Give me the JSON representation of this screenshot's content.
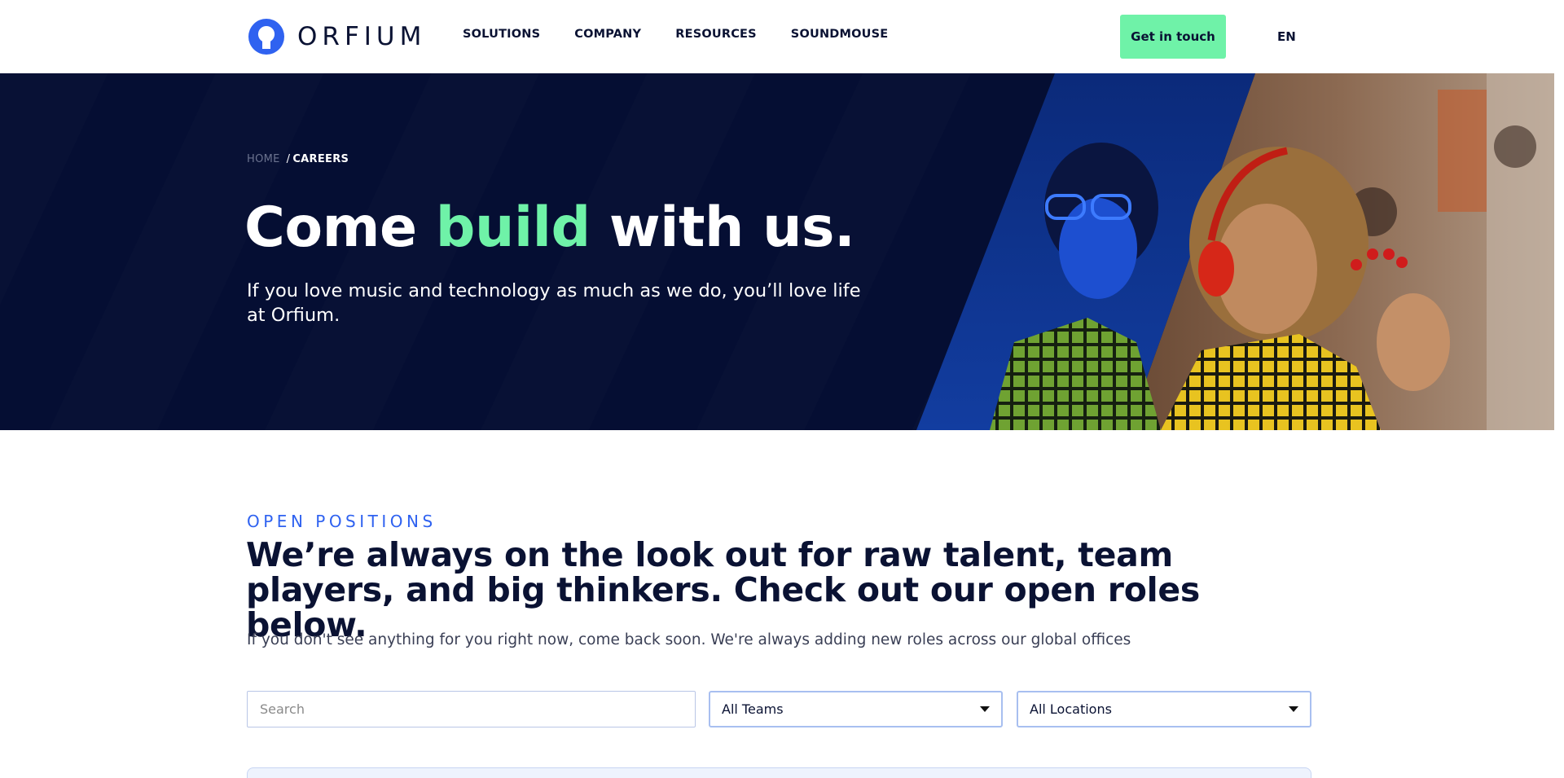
{
  "header": {
    "logo_text": "ORFIUM",
    "nav": [
      "SOLUTIONS",
      "COMPANY",
      "RESOURCES",
      "SOUNDMOUSE"
    ],
    "cta_label": "Get in touch",
    "language": "EN"
  },
  "hero": {
    "breadcrumb": {
      "home": "HOME",
      "separator": "/",
      "current": "CAREERS"
    },
    "title_start": "Come ",
    "title_accent": "build",
    "title_end": " with us.",
    "subtitle": "If you love music and technology as much as we do, you’ll love life at Orfium."
  },
  "positions": {
    "eyebrow": "OPEN POSITIONS",
    "title": "We’re always on the look out for raw talent, team players, and big thinkers. Check out our open roles below.",
    "description": "If you don't see anything for you right now, come back soon. We're always adding new roles across our global offices",
    "search_placeholder": "Search",
    "teams_selected": "All Teams",
    "locations_selected": "All Locations"
  },
  "colors": {
    "brand_blue": "#2f62f0",
    "accent_green": "#6ff2a8",
    "hero_bg": "#050e33",
    "text_dark": "#0a1233"
  },
  "icons": [
    "orfium-logo-icon",
    "caret-down-icon",
    "caret-down-icon"
  ]
}
